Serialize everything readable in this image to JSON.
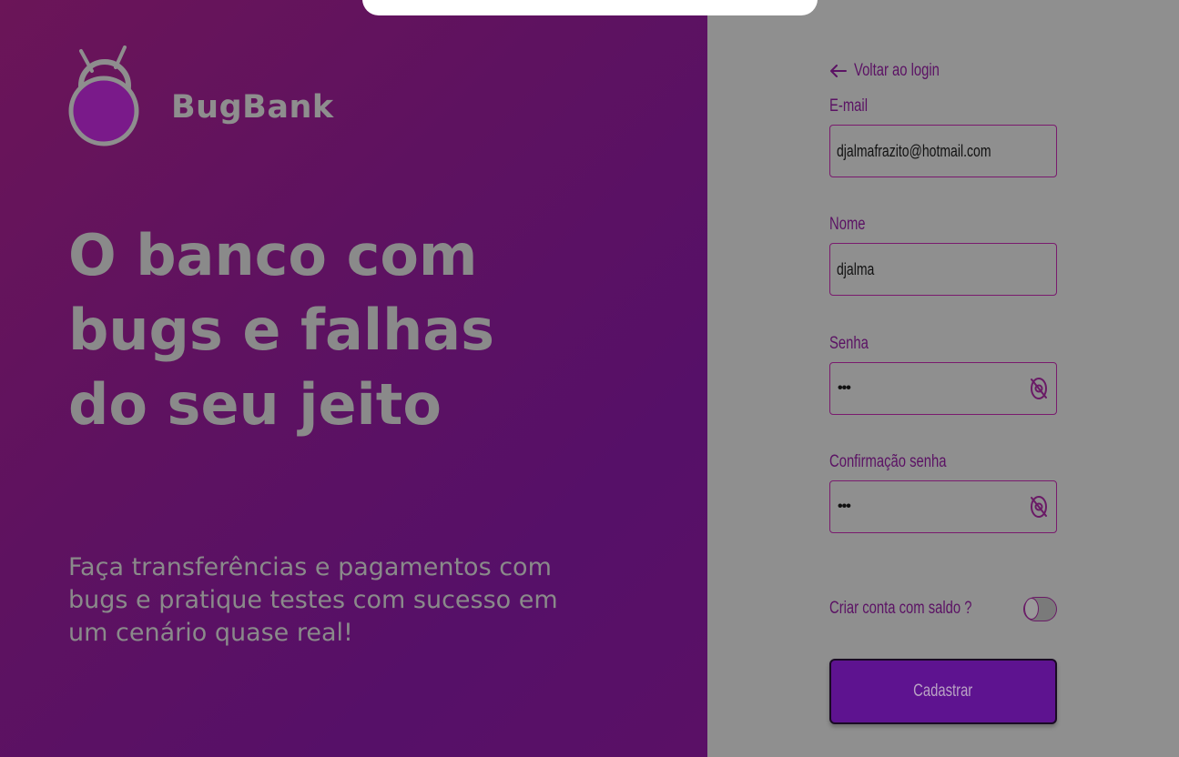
{
  "brand": {
    "name": "BugBank"
  },
  "hero": {
    "headline_lines": [
      "O banco com",
      "bugs e falhas",
      "do seu jeito"
    ],
    "subtext_lines": [
      "Faça transferências e pagamentos com",
      "bugs e pratique testes com sucesso em",
      "um cenário quase real!"
    ]
  },
  "form": {
    "back_link": "Voltar ao login",
    "email": {
      "label": "E-mail",
      "value": "djalmafrazito@hotmail.com"
    },
    "name": {
      "label": "Nome",
      "value": "djalma"
    },
    "password": {
      "label": "Senha",
      "value": "•••"
    },
    "password_confirm": {
      "label": "Confirmação senha",
      "value": "•••"
    },
    "balance_toggle": {
      "label": "Criar conta com saldo ?",
      "enabled": false
    },
    "submit_label": "Cadastrar"
  },
  "icons": {
    "back": "arrow-left-icon",
    "password_visibility": "eye-off-icon",
    "logo": "bug-logo-icon"
  },
  "colors": {
    "accent": "#5e1390",
    "label": "#5b1264",
    "panel_gradient_start": "#6b1558",
    "panel_gradient_end": "#561068"
  }
}
